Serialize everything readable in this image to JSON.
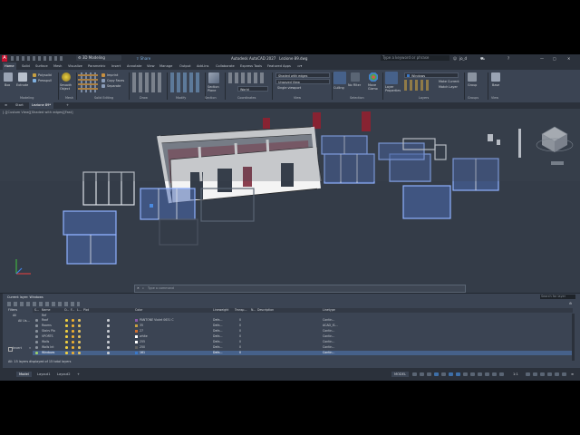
{
  "app": {
    "title": "Autodesk AutoCAD 2027",
    "file_name": "Lezione 89.dwg",
    "workspace": "3D Modeling",
    "share_label": "Share",
    "search_placeholder": "Type a keyword or phrase",
    "user": "jo_d"
  },
  "ribbon_tabs": [
    "Home",
    "Solid",
    "Surface",
    "Mesh",
    "Visualize",
    "Parametric",
    "Insert",
    "Annotate",
    "View",
    "Manage",
    "Output",
    "Add-ins",
    "Collaborate",
    "Express Tools",
    "Featured Apps"
  ],
  "ribbon": {
    "modeling": {
      "box": "Box",
      "extrude": "Extrude",
      "polysolid": "Polysolid",
      "presspull": "Presspull",
      "label": "Modeling"
    },
    "mesh": {
      "smooth_object": "Smooth Object",
      "label": "Mesh"
    },
    "solid_editing": {
      "items": [
        "Imprint",
        "Copy Faces",
        "Separate"
      ],
      "label": "Solid Editing"
    },
    "draw": {
      "label": "Draw"
    },
    "modify": {
      "label": "Modify"
    },
    "section": {
      "section_plane": "Section Plane",
      "label": "Section"
    },
    "coordinates": {
      "world": "World",
      "label": "Coordinates"
    },
    "view": {
      "visual_style": "Shaded with edges",
      "projection": "Unsaved View",
      "viewport": "Single viewport",
      "label": "View"
    },
    "selection": {
      "culling": "Culling",
      "no_filter": "No Filter",
      "move_gizmo": "Move Gizmo",
      "label": "Selection"
    },
    "layers": {
      "layer_properties": "Layer Properties",
      "current_layer": "Windows",
      "make_current": "Make Current",
      "match_layer": "Match Layer",
      "label": "Layers"
    },
    "groups": {
      "group": "Group",
      "label": "Groups"
    },
    "view2": {
      "base": "Base",
      "label": "View"
    }
  },
  "doc_tabs": [
    "Start",
    "Lezione 89*"
  ],
  "viewport": {
    "label": "[-][Custom View][Shaded with edges][Fast]",
    "command_placeholder": "Type a command"
  },
  "layer_palette": {
    "title": "Current layer: Windows",
    "search_placeholder": "Search for layer",
    "filters_label": "Filters",
    "all_label": "All",
    "all_used_label": "All Us...",
    "invert_label": "Invert",
    "status_text": "All: 15 layers displayed of 15 total layers",
    "columns": [
      "S...",
      "Name",
      "O...",
      "F...",
      "L...",
      "Plot",
      "Color",
      "Lineweight",
      "Transp...",
      "N...",
      "Description",
      "Linetype"
    ],
    "rows": [
      {
        "name": "Roof",
        "color": "PANTONE Violet 0631 C",
        "lineweight": "Defa...",
        "transparency": "0",
        "linetype": "Contin...",
        "swatch": "#8a5aa8",
        "selected": false
      },
      {
        "name": "Rooms",
        "color": "35",
        "lineweight": "Defa...",
        "transparency": "0",
        "linetype": "ACAD_IS...",
        "swatch": "#c8a040",
        "selected": false
      },
      {
        "name": "Stairs Pla",
        "color": "27",
        "lineweight": "Defa...",
        "transparency": "0",
        "linetype": "Contin...",
        "swatch": "#d07030",
        "selected": false
      },
      {
        "name": "VPORTS",
        "color": "white",
        "lineweight": "Defa...",
        "transparency": "0",
        "linetype": "Contin...",
        "swatch": "#ffffff",
        "selected": false
      },
      {
        "name": "Walls",
        "color": "255",
        "lineweight": "Defa...",
        "transparency": "0",
        "linetype": "Contin...",
        "swatch": "#ffffff",
        "selected": false
      },
      {
        "name": "Walls Int",
        "color": "250",
        "lineweight": "Defa...",
        "transparency": "0",
        "linetype": "Contin...",
        "swatch": "#606060",
        "selected": false
      },
      {
        "name": "Windows",
        "color": "161",
        "lineweight": "Defa...",
        "transparency": "0",
        "linetype": "Contin...",
        "swatch": "#3a78c8",
        "selected": true
      }
    ]
  },
  "statusbar": {
    "layout_tabs": [
      "Model",
      "Layout1",
      "Layout2"
    ],
    "model_label": "MODEL",
    "scale": "1:1"
  }
}
